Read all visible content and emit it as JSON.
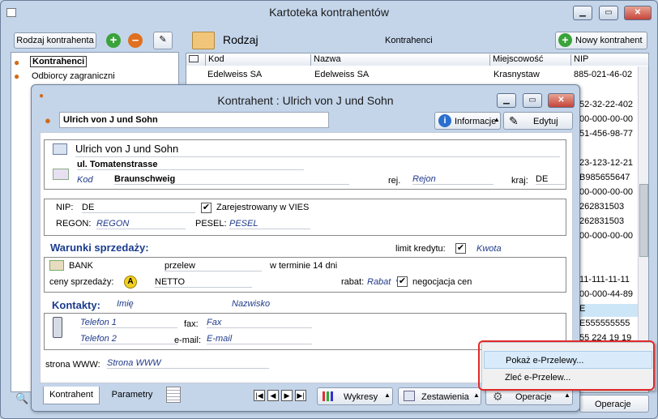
{
  "main": {
    "title": "Kartoteka kontrahentów",
    "rodzaj_btn": "Rodzaj kontrahenta",
    "tree": [
      "Kontrahenci",
      "Odbiorcy zagraniczni"
    ],
    "rodzaj_label": "Rodzaj",
    "kontrahenci_label": "Kontrahenci",
    "nowy_btn": "Nowy kontrahent",
    "columns": [
      "Kod",
      "Nazwa",
      "Miejscowość",
      "NIP"
    ],
    "first_row": {
      "kod": "Edelweiss SA",
      "nazwa": "Edelweiss SA",
      "miejsc": "Krasnystaw",
      "nip": "885-021-46-02"
    },
    "nip_rest": [
      "52-32-22-402",
      "00-000-00-00",
      "51-456-98-77",
      "",
      "23-123-12-21",
      "B985655647",
      "00-000-00-00",
      "262831503",
      "262831503",
      "00-000-00-00",
      "",
      "",
      "11-111-11-11",
      "00-000-44-89",
      "E",
      "E555555555",
      "55 224 19 19"
    ],
    "operacje_btn": "Operacje"
  },
  "dialog": {
    "title": "Kontrahent : Ulrich von J und Sohn",
    "name_field": "Ulrich von J und Sohn",
    "informacje_btn": "Informacje",
    "edytuj_btn": "Edytuj",
    "full_name": "Ulrich von J und Sohn",
    "street": "ul. Tomatenstrasse",
    "kod_label": "Kod",
    "city": "Braunschweig",
    "rej_label": "rej.",
    "region": "Rejon",
    "kraj_label": "kraj:",
    "kraj": "DE",
    "nip_label": "NIP:",
    "nip_val": "DE",
    "vies_label": "Zarejestrowany w VIES",
    "regon_label": "REGON:",
    "regon_val": "REGON",
    "pesel_label": "PESEL:",
    "pesel_val": "PESEL",
    "warunki_label": "Warunki sprzedaży:",
    "limit_label": "limit kredytu:",
    "kwota": "Kwota",
    "bank": "BANK",
    "przelew": "przelew",
    "termin": "w terminie 14 dni",
    "ceny_label": "ceny sprzedaży:",
    "ceny_badge": "A",
    "netto": "NETTO",
    "rabat_label": "rabat:",
    "rabat_val": "Rabat  %",
    "negocjacja": "negocjacja cen",
    "kontakty_label": "Kontakty:",
    "imie": "Imię",
    "nazwisko": "Nazwisko",
    "telefon1": "Telefon 1",
    "telefon2": "Telefon 2",
    "fax_label": "fax:",
    "fax_val": "Fax",
    "email_label": "e-mail:",
    "email_val": "E-mail",
    "www_label": "strona WWW:",
    "www_val": "Strona WWW",
    "tab_kontrahent": "Kontrahent",
    "tab_parametry": "Parametry",
    "wykresy_btn": "Wykresy",
    "zestawienia_btn": "Zestawienia",
    "operacje_btn": "Operacje"
  },
  "context_menu": [
    "Pokaż e-Przelewy...",
    "Zleć e-Przelew..."
  ],
  "icons": {
    "close": "close-icon",
    "minimize": "minimize-icon",
    "maximize": "maximize-icon"
  },
  "colors": {
    "accent": "#1a3b8e",
    "highlight": "#cde6f7",
    "callout": "#e12a2a"
  }
}
